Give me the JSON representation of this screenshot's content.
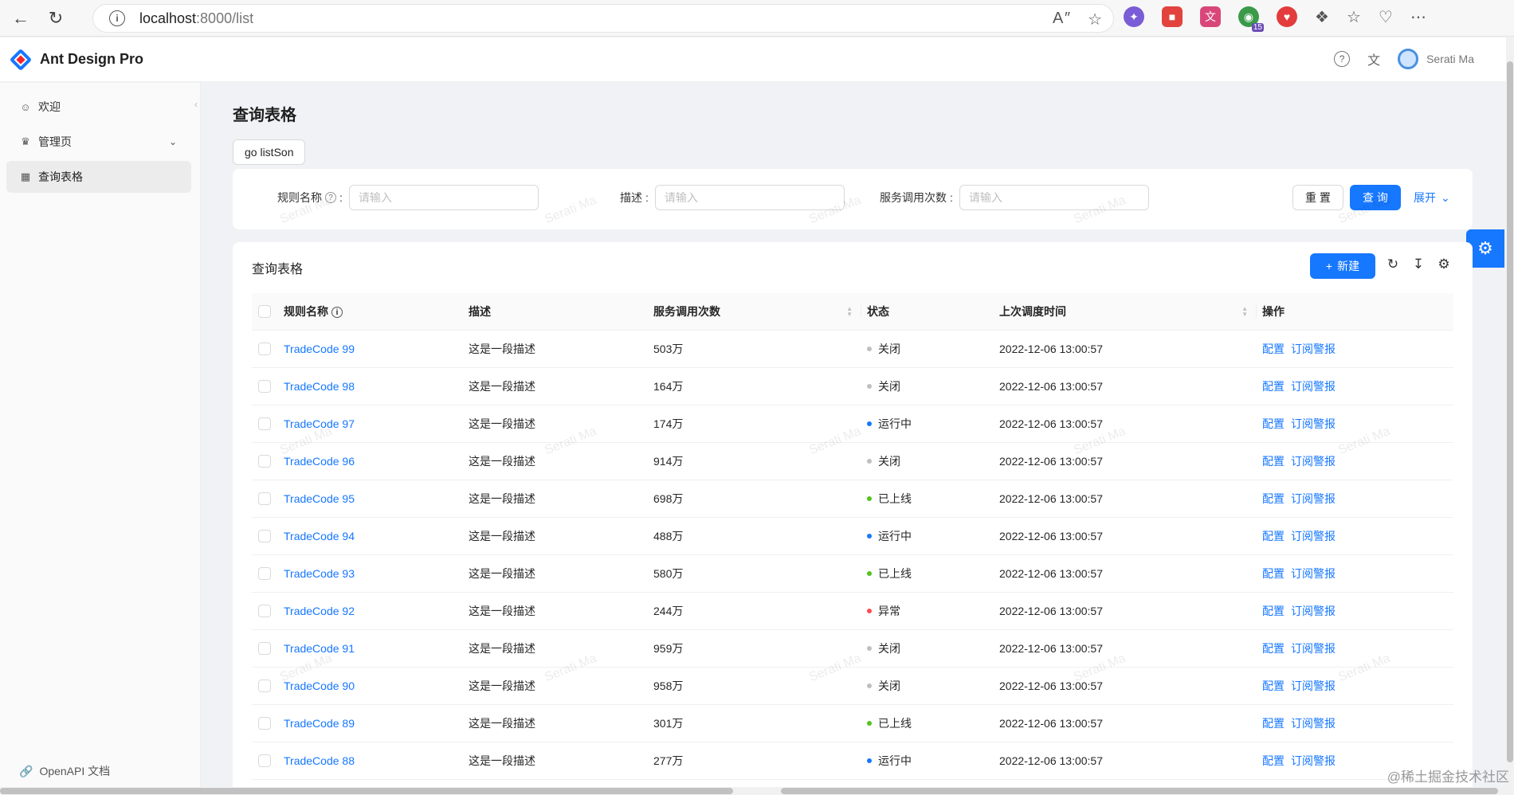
{
  "browser": {
    "url_host": "localhost",
    "url_path": ":8000/list"
  },
  "header": {
    "brand": "Ant Design Pro",
    "user": "Serati Ma"
  },
  "sidebar": {
    "items": [
      {
        "label": "欢迎",
        "icon": "smile-icon"
      },
      {
        "label": "管理页",
        "icon": "crown-icon"
      },
      {
        "label": "查询表格",
        "icon": "table-icon"
      }
    ],
    "footer": "OpenAPI 文档"
  },
  "page": {
    "title": "查询表格",
    "go_button": "go listSon"
  },
  "search": {
    "fields": [
      {
        "label": "规则名称",
        "placeholder": "请输入"
      },
      {
        "label": "描述",
        "placeholder": "请输入"
      },
      {
        "label": "服务调用次数",
        "placeholder": "请输入"
      }
    ],
    "reset": "重 置",
    "submit": "查 询",
    "expand": "展开"
  },
  "table": {
    "title": "查询表格",
    "new_button": "新建",
    "columns": [
      "规则名称",
      "描述",
      "服务调用次数",
      "状态",
      "上次调度时间",
      "操作"
    ],
    "status_colors": {
      "关闭": "#bfbfbf",
      "运行中": "#1677ff",
      "已上线": "#52c41a",
      "异常": "#ff4d4f"
    },
    "rows": [
      {
        "name": "TradeCode 99",
        "desc": "这是一段描述",
        "calls": "503万",
        "status": "关闭",
        "time": "2022-12-06 13:00:57"
      },
      {
        "name": "TradeCode 98",
        "desc": "这是一段描述",
        "calls": "164万",
        "status": "关闭",
        "time": "2022-12-06 13:00:57"
      },
      {
        "name": "TradeCode 97",
        "desc": "这是一段描述",
        "calls": "174万",
        "status": "运行中",
        "time": "2022-12-06 13:00:57"
      },
      {
        "name": "TradeCode 96",
        "desc": "这是一段描述",
        "calls": "914万",
        "status": "关闭",
        "time": "2022-12-06 13:00:57"
      },
      {
        "name": "TradeCode 95",
        "desc": "这是一段描述",
        "calls": "698万",
        "status": "已上线",
        "time": "2022-12-06 13:00:57"
      },
      {
        "name": "TradeCode 94",
        "desc": "这是一段描述",
        "calls": "488万",
        "status": "运行中",
        "time": "2022-12-06 13:00:57"
      },
      {
        "name": "TradeCode 93",
        "desc": "这是一段描述",
        "calls": "580万",
        "status": "已上线",
        "time": "2022-12-06 13:00:57"
      },
      {
        "name": "TradeCode 92",
        "desc": "这是一段描述",
        "calls": "244万",
        "status": "异常",
        "time": "2022-12-06 13:00:57"
      },
      {
        "name": "TradeCode 91",
        "desc": "这是一段描述",
        "calls": "959万",
        "status": "关闭",
        "time": "2022-12-06 13:00:57"
      },
      {
        "name": "TradeCode 90",
        "desc": "这是一段描述",
        "calls": "958万",
        "status": "关闭",
        "time": "2022-12-06 13:00:57"
      },
      {
        "name": "TradeCode 89",
        "desc": "这是一段描述",
        "calls": "301万",
        "status": "已上线",
        "time": "2022-12-06 13:00:57"
      },
      {
        "name": "TradeCode 88",
        "desc": "这是一段描述",
        "calls": "277万",
        "status": "运行中",
        "time": "2022-12-06 13:00:57"
      }
    ],
    "actions": [
      "配置",
      "订阅警报"
    ]
  },
  "watermark": "Serati Ma",
  "corner_mark": "@稀土掘金技术社区"
}
